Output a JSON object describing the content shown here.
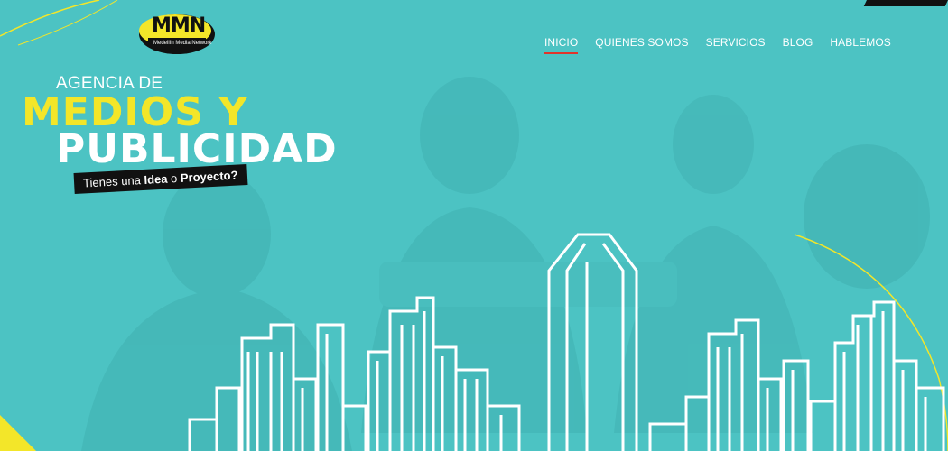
{
  "brand": {
    "logo_text": "MMN",
    "logo_subtitle": "Medellín Media Network"
  },
  "nav": {
    "items": [
      {
        "label": "INICIO",
        "active": true
      },
      {
        "label": "QUIENES SOMOS",
        "active": false
      },
      {
        "label": "SERVICIOS",
        "active": false
      },
      {
        "label": "BLOG",
        "active": false
      },
      {
        "label": "HABLEMOS",
        "active": false
      }
    ]
  },
  "hero": {
    "line1": "AGENCIA DE",
    "line2": "MEDIOS Y",
    "line3": "PUBLICIDAD",
    "tagline_part1": "Tienes una ",
    "tagline_bold1": "Idea",
    "tagline_part2": " o ",
    "tagline_bold2": "Proyecto?"
  },
  "colors": {
    "background": "#4cc3c3",
    "accent_yellow": "#f3e629",
    "active_underline": "#e0342b",
    "dark": "#111111"
  }
}
